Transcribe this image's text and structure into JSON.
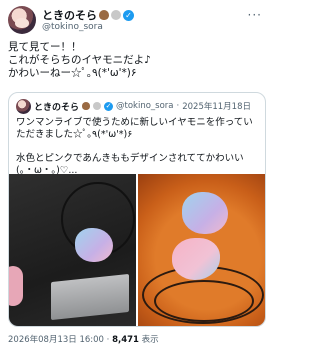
{
  "post": {
    "display_name": "ときのそら",
    "handle": "@tokino_sora",
    "text": "見て見てー！！\nこれがそらちのイヤモニだよ♪\nかわいーねー☆ﾟ｡٩(*'ω'*)۶",
    "timestamp": "2026年08月13日 16:00",
    "views_count": "8,471",
    "views_label": "表示",
    "more_label": "···"
  },
  "quote": {
    "display_name": "ときのそら",
    "handle": "@tokino_sora",
    "date": "2025年11月18日",
    "text": "ワンマンライブで使うために新しいイヤモニを作っていただきました☆ﾟ｡٩(*'ω'*)۶\n\n水色とピンクであんきももデザインされててかわいい(｡・ω・｡)♡...",
    "images": [
      {
        "description": "in-ear monitor on silver plate"
      },
      {
        "description": "blue and pink in-ear monitors"
      }
    ]
  },
  "colors": {
    "verified": "#1d9bf0",
    "muted_text": "#536471",
    "border": "#cfd9de"
  }
}
